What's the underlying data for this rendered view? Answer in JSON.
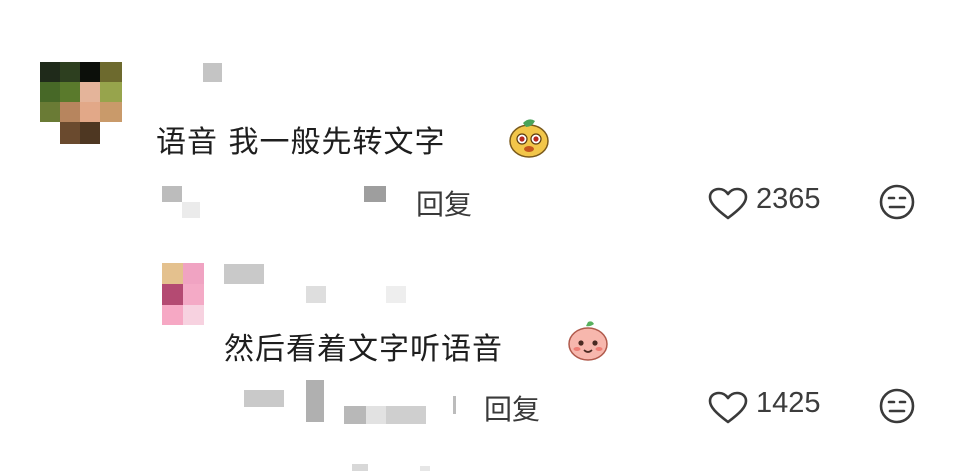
{
  "comments": [
    {
      "text": "语音 我一般先转文字",
      "emoji": "dog-face-emoji",
      "reply_label": "回复",
      "likes": "2365",
      "icons": {
        "like": "heart-outline-icon",
        "dislike": "meh-face-icon"
      }
    },
    {
      "text": "然后看着文字听语音",
      "emoji": "peach-face-emoji",
      "reply_label": "回复",
      "likes": "1425",
      "icons": {
        "like": "heart-outline-icon",
        "dislike": "meh-face-icon"
      }
    }
  ]
}
